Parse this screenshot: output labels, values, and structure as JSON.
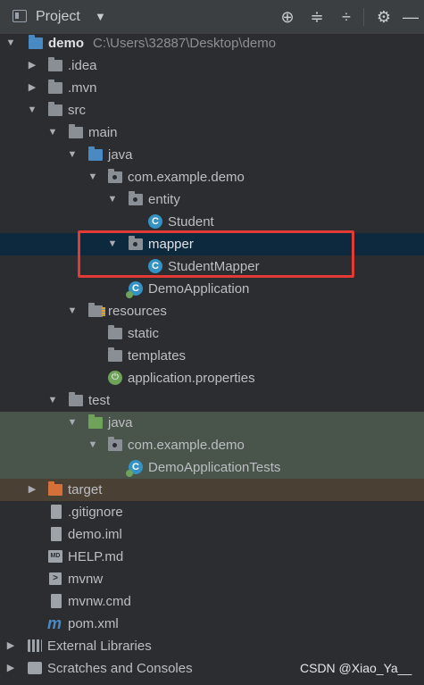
{
  "header": {
    "title": "Project",
    "dropdown_icon": "caret-down-icon",
    "actions": [
      "locate-icon",
      "expand-all-icon",
      "collapse-all-icon",
      "settings-icon",
      "hide-icon"
    ]
  },
  "tree": {
    "root_name": "demo",
    "root_path": "C:\\Users\\32887\\Desktop\\demo",
    "idea": ".idea",
    "mvn": ".mvn",
    "src": "src",
    "main": "main",
    "java": "java",
    "package": "com.example.demo",
    "entity": "entity",
    "student": "Student",
    "mapper": "mapper",
    "student_mapper": "StudentMapper",
    "demo_application": "DemoApplication",
    "resources": "resources",
    "static": "static",
    "templates": "templates",
    "application_properties": "application.properties",
    "test": "test",
    "test_java": "java",
    "test_package": "com.example.demo",
    "demo_application_tests": "DemoApplicationTests",
    "target": "target",
    "gitignore": ".gitignore",
    "demo_iml": "demo.iml",
    "help_md": "HELP.md",
    "mvnw": "mvnw",
    "mvnw_cmd": "mvnw.cmd",
    "pom_xml": "pom.xml",
    "external_libraries": "External Libraries",
    "scratches": "Scratches and Consoles"
  },
  "watermark": "CSDN @Xiao_Ya__",
  "colors": {
    "background": "#2b2d30",
    "selection": "#0d293e",
    "highlight_box": "#e23a34",
    "test_background": "#49544a",
    "target_background": "#4b4034"
  }
}
